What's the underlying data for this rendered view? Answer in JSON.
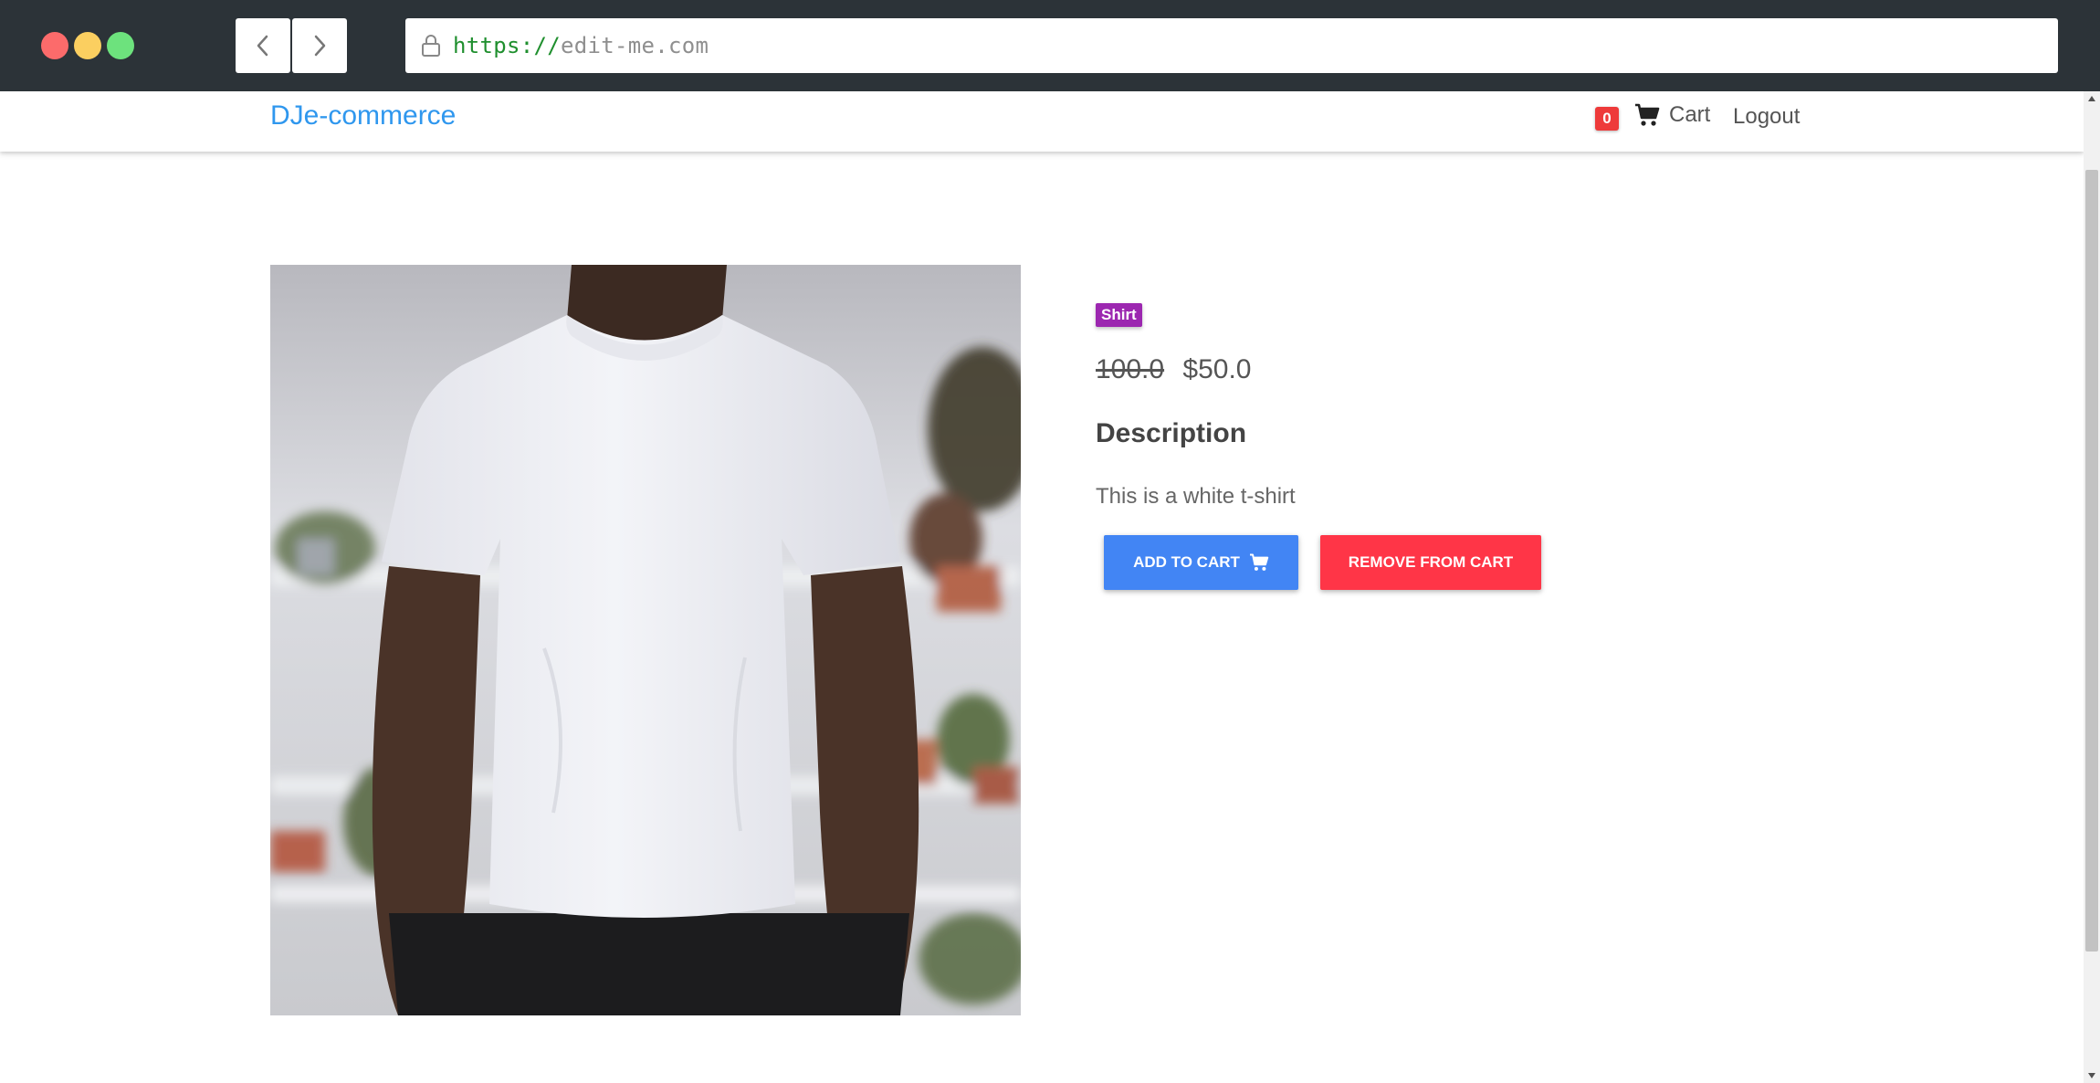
{
  "browser": {
    "url_scheme": "https://",
    "url_host": "edit-me.com"
  },
  "nav": {
    "brand": "DJe-commerce",
    "cart_count": "0",
    "cart_label": "Cart",
    "logout_label": "Logout"
  },
  "product": {
    "category": "Shirt",
    "original_price": "100.0",
    "price": "$50.0",
    "description_heading": "Description",
    "description": "This is a white t-shirt",
    "add_button": "ADD TO CART",
    "remove_button": "REMOVE FROM CART",
    "image_alt": "white t-shirt"
  },
  "colors": {
    "brand": "#2f97ee",
    "category_badge": "#9c27b0",
    "add_button": "#4285f4",
    "remove_button": "#ff3547",
    "cart_badge": "#ee3a3a"
  }
}
